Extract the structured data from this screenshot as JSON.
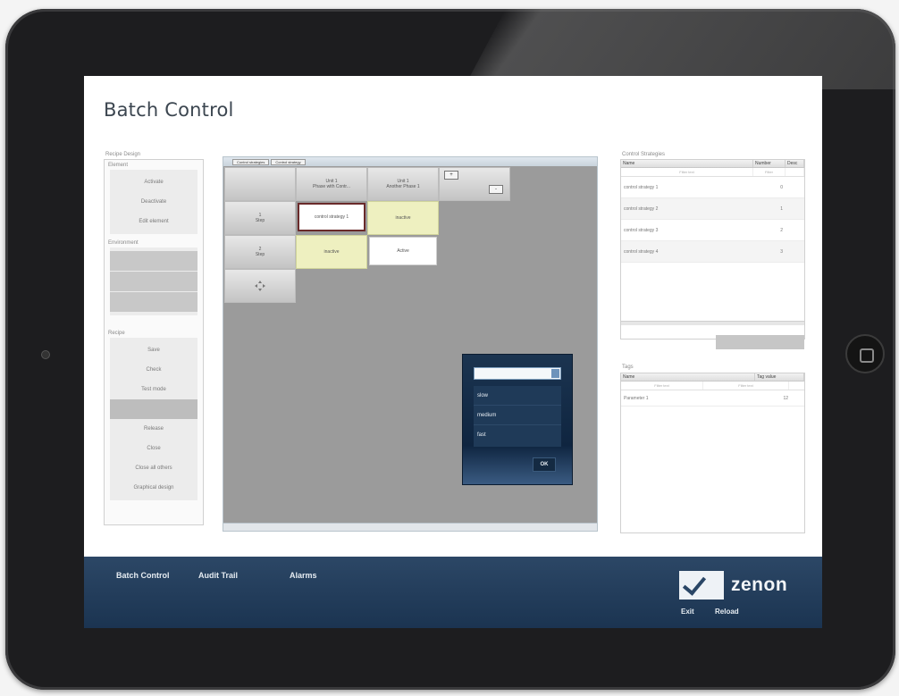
{
  "app": {
    "title": "Batch Control"
  },
  "recipe_design": {
    "label": "Recipe Design",
    "groups": [
      {
        "label": "Element",
        "items": [
          "Activate",
          "Deactivate",
          "Edit element"
        ]
      },
      {
        "label": "Environment",
        "items": [
          "",
          "",
          ""
        ]
      },
      {
        "label": "Recipe",
        "items": [
          "Save",
          "Check",
          "Test mode",
          "",
          "Release",
          "Close",
          "Close all others",
          "Graphical design"
        ]
      }
    ]
  },
  "editor": {
    "tabs": [
      "Control strategies",
      "Control strategy"
    ],
    "headers": [
      "Unit 1\nPhase with Contr...",
      "Unit 1\nAnother Phase 1"
    ],
    "rows": [
      {
        "label": "1\nStep",
        "cells": [
          "control strategy 1",
          "inactive"
        ]
      },
      {
        "label": "2\nStep",
        "cells": [
          "inactive",
          "Active"
        ]
      }
    ],
    "zoom_plus": "+",
    "zoom_minus": "-"
  },
  "dialog": {
    "input_value": "",
    "options": [
      "slow",
      "medium",
      "fast"
    ],
    "ok_label": "OK"
  },
  "control_strategies": {
    "label": "Control Strategies",
    "columns": [
      "Name",
      "Number",
      "Desc"
    ],
    "filters": [
      "Filter text",
      "Filter"
    ],
    "rows": [
      {
        "name": "control strategy 1",
        "number": "0"
      },
      {
        "name": "control strategy 2",
        "number": "1"
      },
      {
        "name": "control strategy 3",
        "number": "2"
      },
      {
        "name": "control strategy 4",
        "number": "3"
      }
    ]
  },
  "tags": {
    "label": "Tags",
    "columns": [
      "Name",
      "Tag value"
    ],
    "filters": [
      "Filter text",
      "Filter text"
    ],
    "rows": [
      {
        "name": "Parameter 1",
        "value": "12"
      }
    ]
  },
  "footer": {
    "nav": [
      "Batch Control",
      "Audit Trail",
      "Alarms"
    ],
    "logo_text": "zenon",
    "exit_label": "Exit",
    "reload_label": "Reload"
  }
}
